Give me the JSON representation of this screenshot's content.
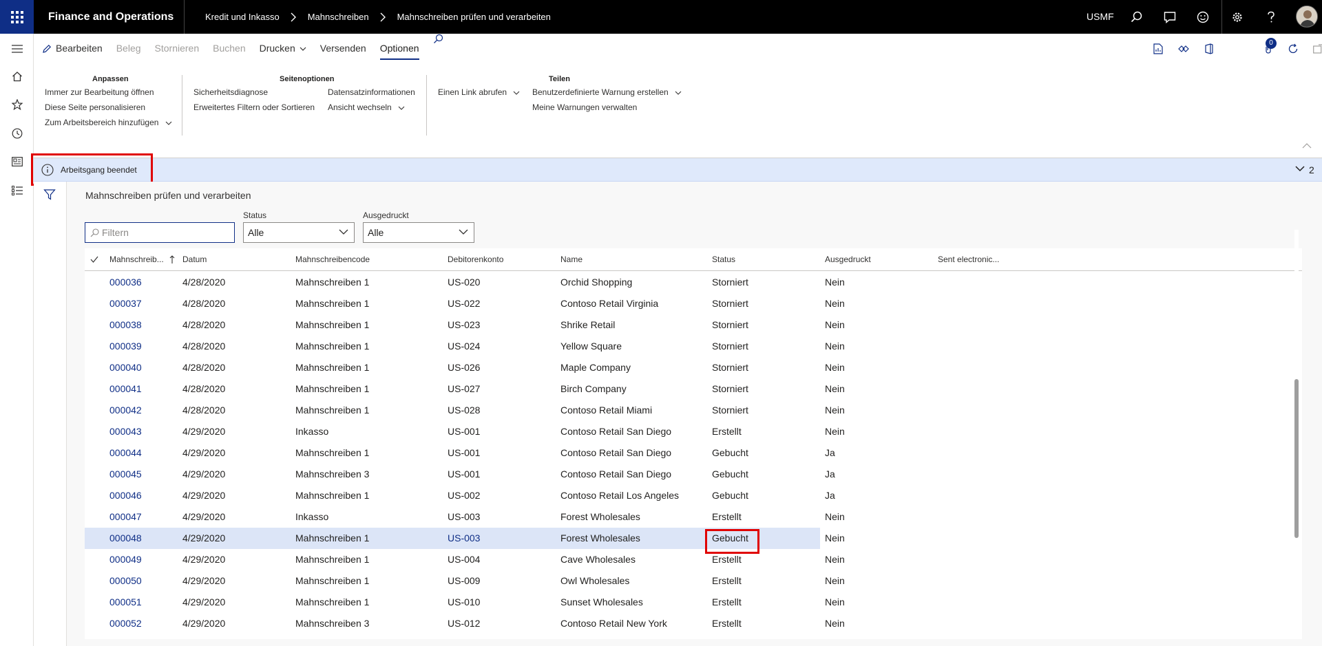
{
  "app": {
    "title": "Finance and Operations",
    "breadcrumbs": [
      "Kredit und Inkasso",
      "Mahnschreiben",
      "Mahnschreiben prüfen und verarbeiten"
    ],
    "company": "USMF"
  },
  "actionpane": {
    "tabs": [
      {
        "label": "Bearbeiten",
        "state": "enabled"
      },
      {
        "label": "Beleg",
        "state": "disabled"
      },
      {
        "label": "Stornieren",
        "state": "disabled"
      },
      {
        "label": "Buchen",
        "state": "disabled"
      },
      {
        "label": "Drucken",
        "state": "enabled"
      },
      {
        "label": "Versenden",
        "state": "enabled"
      },
      {
        "label": "Optionen",
        "state": "active"
      }
    ],
    "notification_count": "0",
    "groups": {
      "anpassen": {
        "title": "Anpassen",
        "items": [
          "Immer zur Bearbeitung öffnen",
          "Diese Seite personalisieren",
          "Zum Arbeitsbereich hinzufügen"
        ]
      },
      "seitenoptionen": {
        "title": "Seitenoptionen",
        "items": [
          "Sicherheitsdiagnose",
          "Erweitertes Filtern oder Sortieren",
          "Datensatzinformationen",
          "Ansicht wechseln"
        ]
      },
      "teilen": {
        "title": "Teilen",
        "items": [
          "Einen Link abrufen",
          "Benutzerdefinierte Warnung erstellen",
          "Meine Warnungen verwalten"
        ]
      }
    }
  },
  "message": {
    "text": "Arbeitsgang beendet",
    "count": "2"
  },
  "page": {
    "title": "Mahnschreiben prüfen und verarbeiten",
    "filter_placeholder": "Filtern",
    "status_label": "Status",
    "status_value": "Alle",
    "printed_label": "Ausgedruckt",
    "printed_value": "Alle"
  },
  "grid": {
    "columns": [
      "Mahnschreib...",
      "Datum",
      "Mahnschreibencode",
      "Debitorenkonto",
      "Name",
      "Status",
      "Ausgedruckt",
      "Sent electronic..."
    ],
    "rows": [
      [
        "000036",
        "4/28/2020",
        "Mahnschreiben 1",
        "US-020",
        "Orchid Shopping",
        "Storniert",
        "Nein"
      ],
      [
        "000037",
        "4/28/2020",
        "Mahnschreiben 1",
        "US-022",
        "Contoso Retail Virginia",
        "Storniert",
        "Nein"
      ],
      [
        "000038",
        "4/28/2020",
        "Mahnschreiben 1",
        "US-023",
        "Shrike Retail",
        "Storniert",
        "Nein"
      ],
      [
        "000039",
        "4/28/2020",
        "Mahnschreiben 1",
        "US-024",
        "Yellow Square",
        "Storniert",
        "Nein"
      ],
      [
        "000040",
        "4/28/2020",
        "Mahnschreiben 1",
        "US-026",
        "Maple Company",
        "Storniert",
        "Nein"
      ],
      [
        "000041",
        "4/28/2020",
        "Mahnschreiben 1",
        "US-027",
        "Birch Company",
        "Storniert",
        "Nein"
      ],
      [
        "000042",
        "4/28/2020",
        "Mahnschreiben 1",
        "US-028",
        "Contoso Retail Miami",
        "Storniert",
        "Nein"
      ],
      [
        "000043",
        "4/29/2020",
        "Inkasso",
        "US-001",
        "Contoso Retail San Diego",
        "Erstellt",
        "Nein"
      ],
      [
        "000044",
        "4/29/2020",
        "Mahnschreiben 1",
        "US-001",
        "Contoso Retail San Diego",
        "Gebucht",
        "Ja"
      ],
      [
        "000045",
        "4/29/2020",
        "Mahnschreiben 3",
        "US-001",
        "Contoso Retail San Diego",
        "Gebucht",
        "Ja"
      ],
      [
        "000046",
        "4/29/2020",
        "Mahnschreiben 1",
        "US-002",
        "Contoso Retail Los Angeles",
        "Gebucht",
        "Ja"
      ],
      [
        "000047",
        "4/29/2020",
        "Inkasso",
        "US-003",
        "Forest Wholesales",
        "Erstellt",
        "Nein"
      ],
      [
        "000048",
        "4/29/2020",
        "Mahnschreiben 1",
        "US-003",
        "Forest Wholesales",
        "Gebucht",
        "Nein"
      ],
      [
        "000049",
        "4/29/2020",
        "Mahnschreiben 1",
        "US-004",
        "Cave Wholesales",
        "Erstellt",
        "Nein"
      ],
      [
        "000050",
        "4/29/2020",
        "Mahnschreiben 1",
        "US-009",
        "Owl Wholesales",
        "Erstellt",
        "Nein"
      ],
      [
        "000051",
        "4/29/2020",
        "Mahnschreiben 1",
        "US-010",
        "Sunset Wholesales",
        "Erstellt",
        "Nein"
      ],
      [
        "000052",
        "4/29/2020",
        "Mahnschreiben 3",
        "US-012",
        "Contoso Retail New York",
        "Erstellt",
        "Nein"
      ]
    ],
    "selected_row_index": 12
  },
  "colors": {
    "accent": "#0f2e86",
    "topbar": "#000000",
    "message_bg": "#dfe9fb",
    "selected_row": "#dce5f7",
    "highlight": "#e00000"
  }
}
